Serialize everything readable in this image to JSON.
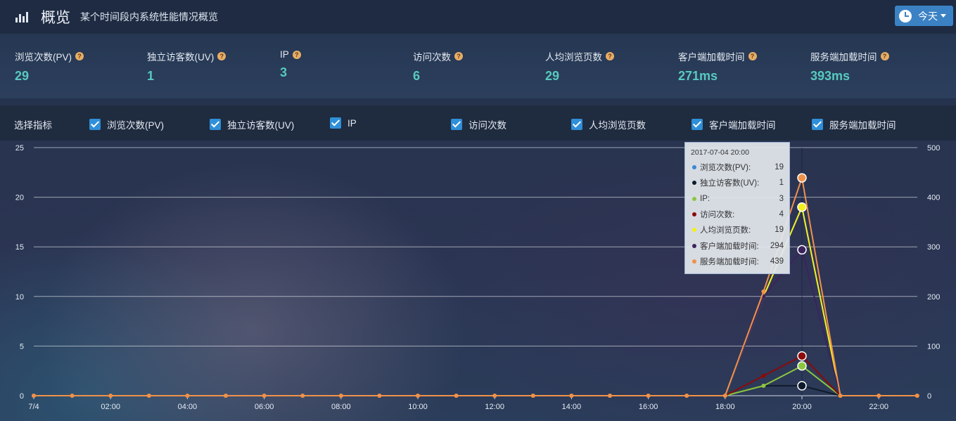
{
  "header": {
    "title": "概览",
    "subtitle": "某个时间段内系统性能情况概览",
    "date_button": "今天"
  },
  "stats": [
    {
      "label": "浏览次数(PV)",
      "value": "29"
    },
    {
      "label": "独立访客数(UV)",
      "value": "1"
    },
    {
      "label": "IP",
      "value": "3"
    },
    {
      "label": "访问次数",
      "value": "6"
    },
    {
      "label": "人均浏览页数",
      "value": "29"
    },
    {
      "label": "客户端加载时间",
      "value": "271ms"
    },
    {
      "label": "服务端加载时间",
      "value": "393ms"
    }
  ],
  "metrics": {
    "title": "选择指标",
    "items": [
      {
        "label": "浏览次数(PV)",
        "checked": true
      },
      {
        "label": "独立访客数(UV)",
        "checked": true
      },
      {
        "label": "IP",
        "checked": true
      },
      {
        "label": "访问次数",
        "checked": true
      },
      {
        "label": "人均浏览页数",
        "checked": true
      },
      {
        "label": "客户端加载时间",
        "checked": true
      },
      {
        "label": "服务端加载时间",
        "checked": true
      }
    ]
  },
  "tooltip": {
    "time": "2017-07-04 20:00",
    "rows": [
      {
        "name": "浏览次数(PV):",
        "value": "19",
        "color": "#3a86d6"
      },
      {
        "name": "独立访客数(UV):",
        "value": "1",
        "color": "#0f1b2b"
      },
      {
        "name": "IP:",
        "value": "3",
        "color": "#8cc63f"
      },
      {
        "name": "访问次数:",
        "value": "4",
        "color": "#8b0a0a"
      },
      {
        "name": "人均浏览页数:",
        "value": "19",
        "color": "#f3f01d"
      },
      {
        "name": "客户端加载时间:",
        "value": "294",
        "color": "#3c235e"
      },
      {
        "name": "服务端加载时间:",
        "value": "439",
        "color": "#f19149"
      }
    ]
  },
  "chart_data": {
    "type": "line",
    "x": [
      0,
      1,
      2,
      3,
      4,
      5,
      6,
      7,
      8,
      9,
      10,
      11,
      12,
      13,
      14,
      15,
      16,
      17,
      18,
      19,
      20,
      21,
      22,
      23
    ],
    "x_tick_labels": [
      "7/4",
      "02:00",
      "04:00",
      "06:00",
      "08:00",
      "10:00",
      "12:00",
      "14:00",
      "16:00",
      "18:00",
      "20:00",
      "22:00"
    ],
    "x_tick_positions": [
      0,
      2,
      4,
      6,
      8,
      10,
      12,
      14,
      16,
      18,
      20,
      22
    ],
    "y_left": {
      "ticks": [
        "0",
        "5",
        "10",
        "15",
        "20",
        "25"
      ],
      "min": 0,
      "max": 25
    },
    "y_right": {
      "ticks": [
        "0",
        "100",
        "200",
        "300",
        "400",
        "500"
      ],
      "min": 0,
      "max": 500
    },
    "grid": true,
    "highlight_x": 20,
    "series": [
      {
        "name": "浏览次数(PV)",
        "axis": "left",
        "color": "#3a86d6",
        "values": [
          0,
          0,
          0,
          0,
          0,
          0,
          0,
          0,
          0,
          0,
          0,
          0,
          0,
          0,
          0,
          0,
          0,
          0,
          0,
          10,
          19,
          0,
          0,
          0
        ]
      },
      {
        "name": "独立访客数(UV)",
        "axis": "left",
        "color": "#0f1b2b",
        "values": [
          0,
          0,
          0,
          0,
          0,
          0,
          0,
          0,
          0,
          0,
          0,
          0,
          0,
          0,
          0,
          0,
          0,
          0,
          0,
          1,
          1,
          0,
          0,
          0
        ]
      },
      {
        "name": "IP",
        "axis": "left",
        "color": "#8cc63f",
        "values": [
          0,
          0,
          0,
          0,
          0,
          0,
          0,
          0,
          0,
          0,
          0,
          0,
          0,
          0,
          0,
          0,
          0,
          0,
          0,
          1,
          3,
          0,
          0,
          0
        ]
      },
      {
        "name": "访问次数",
        "axis": "left",
        "color": "#8b0a0a",
        "values": [
          0,
          0,
          0,
          0,
          0,
          0,
          0,
          0,
          0,
          0,
          0,
          0,
          0,
          0,
          0,
          0,
          0,
          0,
          0,
          2,
          4,
          0,
          0,
          0
        ]
      },
      {
        "name": "人均浏览页数",
        "axis": "left",
        "color": "#f3f01d",
        "values": [
          0,
          0,
          0,
          0,
          0,
          0,
          0,
          0,
          0,
          0,
          0,
          0,
          0,
          0,
          0,
          0,
          0,
          0,
          0,
          10,
          19,
          0,
          0,
          0
        ]
      },
      {
        "name": "客户端加载时间",
        "axis": "right",
        "color": "#3c235e",
        "values": [
          0,
          0,
          0,
          0,
          0,
          0,
          0,
          0,
          0,
          0,
          0,
          0,
          0,
          0,
          0,
          0,
          0,
          0,
          0,
          200,
          294,
          0,
          0,
          0
        ]
      },
      {
        "name": "服务端加载时间",
        "axis": "right",
        "color": "#f19149",
        "values": [
          0,
          0,
          0,
          0,
          0,
          0,
          0,
          0,
          0,
          0,
          0,
          0,
          0,
          0,
          0,
          0,
          0,
          0,
          0,
          210,
          439,
          0,
          0,
          0
        ]
      }
    ]
  }
}
